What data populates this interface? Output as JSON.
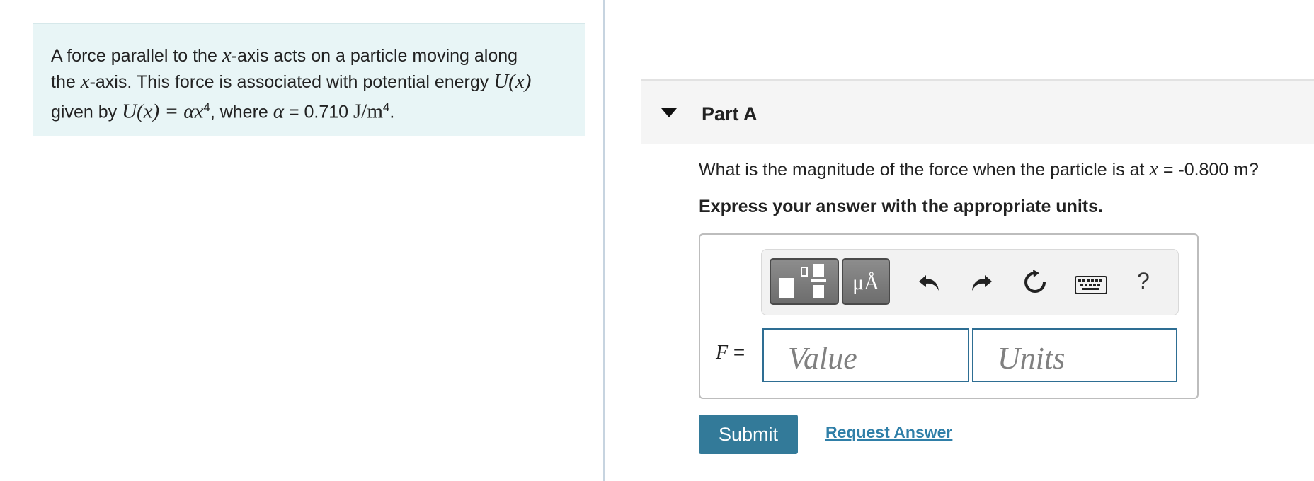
{
  "problem": {
    "line1_a": "A force parallel to the ",
    "x": "x",
    "line1_b": "-axis acts on a particle moving along",
    "line2_a": "the ",
    "line2_b": "-axis. This force is associated with potential energy ",
    "Ux": "U(x)",
    "line3_a": "given by ",
    "formula": "U(x) = αx",
    "exp4": "4",
    "line3_b": ", where ",
    "alpha": "α",
    "line3_c": " = 0.710 ",
    "unit": "J/m",
    "line3_d": "."
  },
  "part": {
    "title": "Part A"
  },
  "question": {
    "text_a": "What is the magnitude of the force when the particle is at ",
    "x": "x",
    "text_b": " = -0.800 ",
    "unit": "m",
    "text_c": "?"
  },
  "instruction": "Express your answer with the appropriate units.",
  "toolbar": {
    "units_label": "μÅ",
    "help_label": "?"
  },
  "answer": {
    "variable": "F",
    "equals": " =",
    "value_placeholder": "Value",
    "units_placeholder": "Units"
  },
  "actions": {
    "submit_label": "Submit",
    "request_label": "Request Answer"
  }
}
